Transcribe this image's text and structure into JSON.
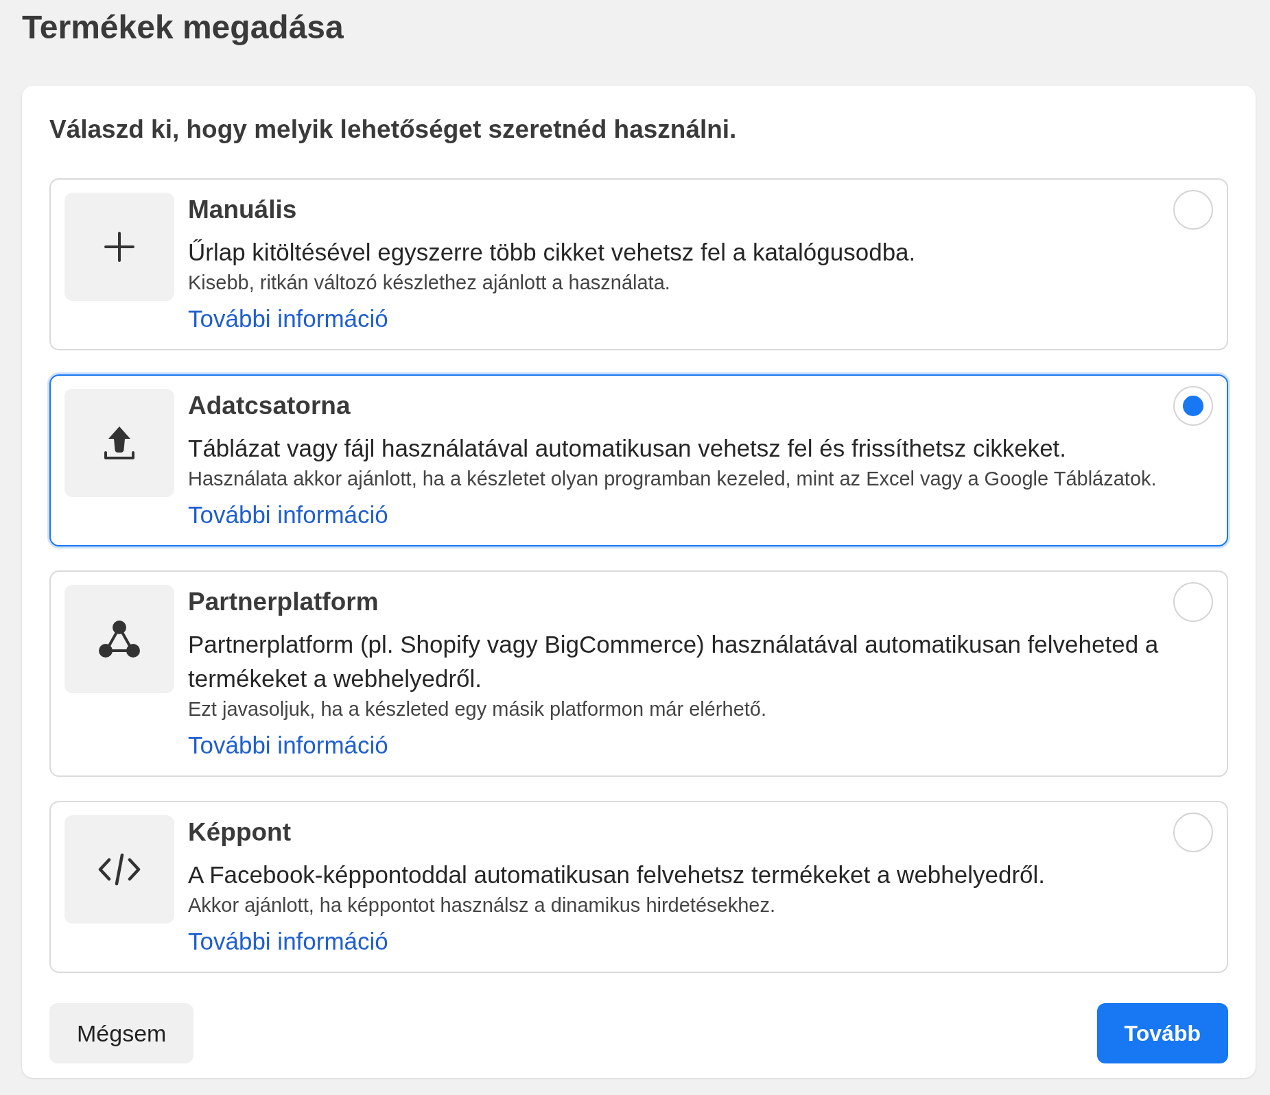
{
  "page": {
    "title": "Termékek megadása"
  },
  "card": {
    "heading": "Válaszd ki, hogy melyik lehetőséget szeretnéd használni.",
    "options": [
      {
        "title": "Manuális",
        "description": "Űrlap kitöltésével egyszerre több cikket vehetsz fel a katalógusodba.",
        "note": "Kisebb, ritkán változó készlethez ajánlott a használata.",
        "link": "További információ",
        "selected": false
      },
      {
        "title": "Adatcsatorna",
        "description": "Táblázat vagy fájl használatával automatikusan vehetsz fel és frissíthetsz cikkeket.",
        "note": "Használata akkor ajánlott, ha a készletet olyan programban kezeled, mint az Excel vagy a Google Táblázatok.",
        "link": "További információ",
        "selected": true
      },
      {
        "title": "Partnerplatform",
        "description": "Partnerplatform (pl. Shopify vagy BigCommerce) használatával automatikusan felveheted a termékeket a webhelyedről.",
        "note": "Ezt javasoljuk, ha a készleted egy másik platformon már elérhető.",
        "link": "További információ",
        "selected": false
      },
      {
        "title": "Képpont",
        "description": "A Facebook-képpontoddal automatikusan felvehetsz termékeket a webhelyedről.",
        "note": "Akkor ajánlott, ha képpontot használsz a dinamikus hirdetésekhez.",
        "link": "További információ",
        "selected": false
      }
    ]
  },
  "buttons": [
    {
      "label": "Mégsem",
      "kind": "secondary"
    },
    {
      "label": "Tovább",
      "kind": "primary"
    }
  ]
}
